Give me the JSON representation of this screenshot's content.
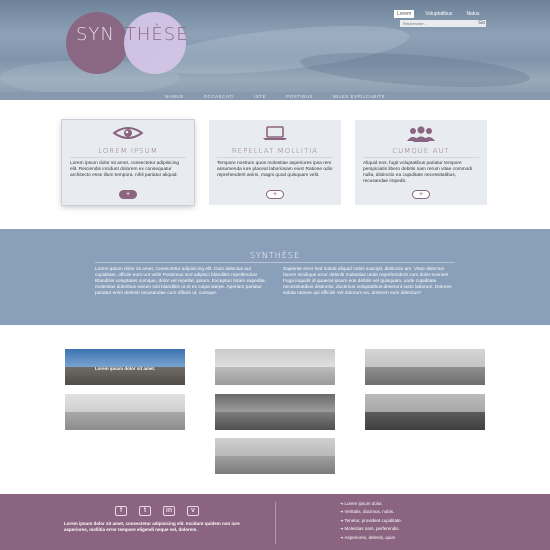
{
  "header": {
    "logo_left": "SYN",
    "logo_right": "THÈSE",
    "top_nav": [
      "Lorem",
      "Voluptatibus",
      "Natus"
    ],
    "search_placeholder": "Rechercher...",
    "search_button": "Go",
    "main_nav": [
      "NAMUS",
      "OCCAECATI",
      "ISTE",
      "POSTIBUS",
      "MILES EXPLICABITE"
    ],
    "colors": {
      "accent": "#8a6480",
      "lilac": "#d3c4e6",
      "band": "#8a9fba"
    }
  },
  "cards": [
    {
      "icon": "eye-icon",
      "title": "LOREM IPSUM",
      "text": "Lorem ipsum dolor sit amet, consectetur adipisicing elit. Reiciendis incidunt dolorem ex consequatur architecto esse illum tempora, nihil pariatur aliquid.",
      "button": "+"
    },
    {
      "icon": "laptop-icon",
      "title": "REPELLAT MOLLITIA",
      "text": "Tempore nostrum quos molestiae asperiores ipsa rem assumenda iure placeat laboriosam eius! Ratione odio reprehenderit animi, magni quod quisquam velit.",
      "button": "+"
    },
    {
      "icon": "users-icon",
      "title": "CUMQUE AUT",
      "text": "Aliquid eos, fugit voluptatibus pariatur tempore perspiciatis libero debitis nam rerum vitae commodi nulla, distinctio ea cupiditate necessitatibus, recusandae impedit.",
      "button": "+"
    }
  ],
  "synthese": {
    "title": "SYNTHÈSE",
    "col1": "Lorem ipsum dolor sit amet, consectetur adipisicing elit. Duis delectus aut cupiditate, officiis eum unt velit! Possimus sed adipisci blanditiis repellendus! Blanditiis voluptates cumque, dolor vel repellat, ipsum. Excepturi totam expedita, molestias doloribus earum sint blanditiis ut et ex culpa saepe. Aperiam pariatur pariatur enim deleniti recusandae cum officiis ut, cumque.",
    "col2": "Sapiente error sed soluta aliquid nobis suscipit, distinctio am. Vitae delectus facere similique error deleniti molestias unde reprehenderit cum dolor eveniet! Fuga inquidit id quaerat ipsum eos debitis vel quisquam, unde cupiditate necessitatibus distinctio, ductimus voluptatibus deserunt iusto laborum. Dolores soluta ratione qui officiis! Vel dolorum ea, dolorem eum delectus?"
  },
  "gallery": {
    "first_caption": "Lorem ipsum dolor sit amet.",
    "images": [
      "beach-photo",
      "dunes-photo",
      "coast-photo",
      "shore-photo",
      "sand-photo",
      "sea-photo",
      "desert-photo"
    ]
  },
  "footer": {
    "socials": [
      "f",
      "t",
      "in",
      "v"
    ],
    "blurb": "Lorem ipsum dolor sit amet, consectetur adipisicing elit. Incidunt quidem non iure asperiores, mollitia error tempore eligendi neque vel, dolorem.",
    "links": [
      "Lorem ipsum dolor.",
      "Veritatis, ducimus, nobis.",
      "Tenetur, provident cupiditate.",
      "Molestias nam, perferendis.",
      "Asperiores, deleniti, quia!"
    ]
  }
}
